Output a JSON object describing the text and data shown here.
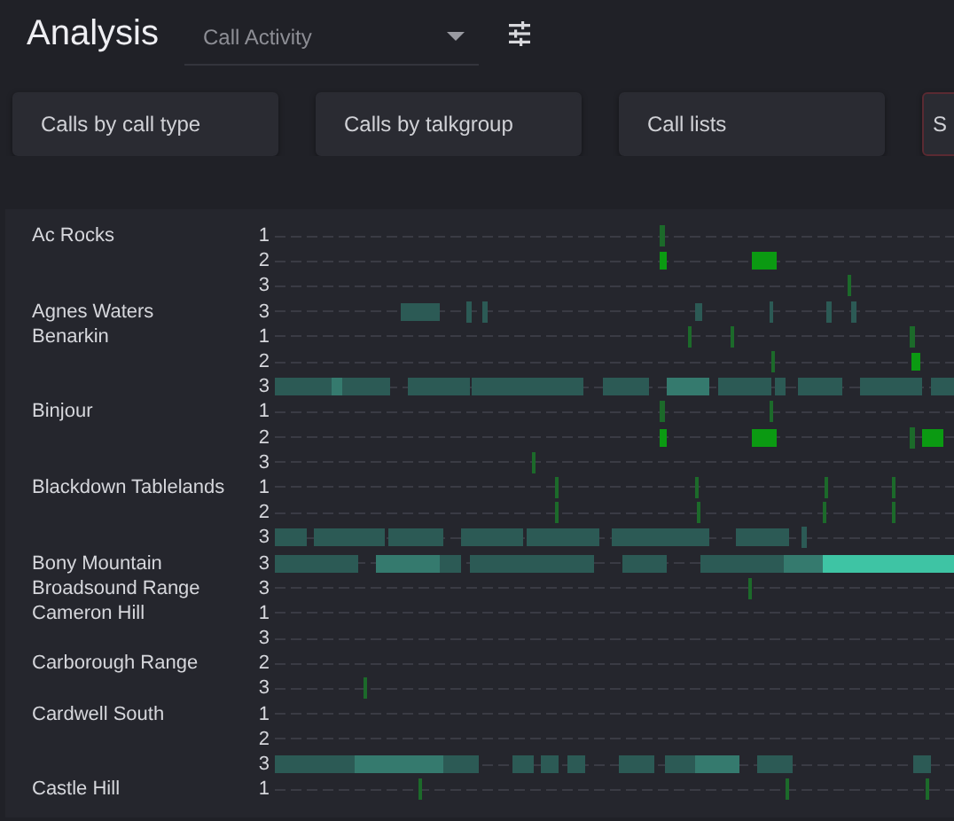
{
  "header": {
    "title": "Analysis",
    "view_select": {
      "value": "Call Activity"
    }
  },
  "report_buttons": [
    {
      "label": "Calls by call type",
      "highlighted": false
    },
    {
      "label": "Calls by talkgroup",
      "highlighted": false
    },
    {
      "label": "Call lists",
      "highlighted": false
    },
    {
      "label": "S",
      "highlighted": true
    }
  ],
  "activity_rows": [
    {
      "site": "Ac Rocks",
      "channel": "1"
    },
    {
      "channel": "2"
    },
    {
      "channel": "3"
    },
    {
      "site": "Agnes Waters",
      "channel": "3"
    },
    {
      "site": "Benarkin",
      "channel": "1"
    },
    {
      "channel": "2"
    },
    {
      "channel": "3"
    },
    {
      "site": "Binjour",
      "channel": "1"
    },
    {
      "channel": "2"
    },
    {
      "channel": "3"
    },
    {
      "site": "Blackdown Tablelands",
      "channel": "1"
    },
    {
      "channel": "2"
    },
    {
      "channel": "3"
    },
    {
      "site": "Bony Mountain",
      "channel": "3"
    },
    {
      "site": "Broadsound Range",
      "channel": "3"
    },
    {
      "site": "Cameron Hill",
      "channel": "1"
    },
    {
      "channel": "3"
    },
    {
      "site": "Carborough Range",
      "channel": "2"
    },
    {
      "channel": "3"
    },
    {
      "site": "Cardwell South",
      "channel": "1"
    },
    {
      "channel": "2"
    },
    {
      "channel": "3"
    },
    {
      "site": "Castle Hill",
      "channel": "1"
    }
  ]
}
